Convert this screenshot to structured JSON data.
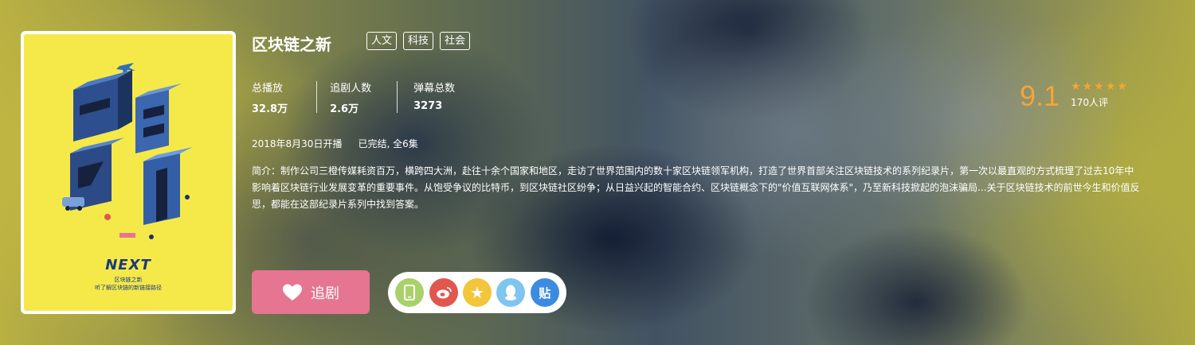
{
  "show": {
    "title": "区块链之新",
    "tags": [
      "人文",
      "科技",
      "社会"
    ],
    "poster": {
      "logo": "NEXT",
      "subtitle_1": "区块链之新",
      "subtitle_2": "听了解区块链的新链接路径"
    }
  },
  "stats": [
    {
      "label": "总播放",
      "value": "32.8万"
    },
    {
      "label": "追剧人数",
      "value": "2.6万"
    },
    {
      "label": "弹幕总数",
      "value": "3273"
    }
  ],
  "meta": {
    "air_date": "2018年8月30日开播",
    "status": "已完结, 全6集"
  },
  "description": "简介：制作公司三橙传媒耗资百万，横跨四大洲，赴往十余个国家和地区，走访了世界范围内的数十家区块链领军机构，打造了世界首部关注区块链技术的系列纪录片，第一次以最直观的方式梳理了过去10年中影响着区块链行业发展变革的重要事件。从饱受争议的比特币，到区块链社区纷争；从日益兴起的智能合约、区块链概念下的\"价值互联网体系\"，乃至新科技掀起的泡沫骗局...关于区块链技术的前世今生和价值反思，都能在这部纪录片系列中找到答案。",
  "rating": {
    "score": "9.1",
    "count": "170人评",
    "stars": 5,
    "color": "#f4a537"
  },
  "actions": {
    "follow_label": "追剧",
    "follow_color": "#e57591",
    "share": [
      {
        "name": "phone",
        "glyph": "▯",
        "color": "#a9d16a"
      },
      {
        "name": "weibo",
        "glyph": "◉",
        "color": "#e1564f"
      },
      {
        "name": "qzone",
        "glyph": "★",
        "color": "#f2c53b"
      },
      {
        "name": "qq",
        "glyph": "●",
        "color": "#7ec5ef"
      },
      {
        "name": "tieba",
        "glyph": "贴",
        "color": "#3c8be0"
      }
    ]
  }
}
